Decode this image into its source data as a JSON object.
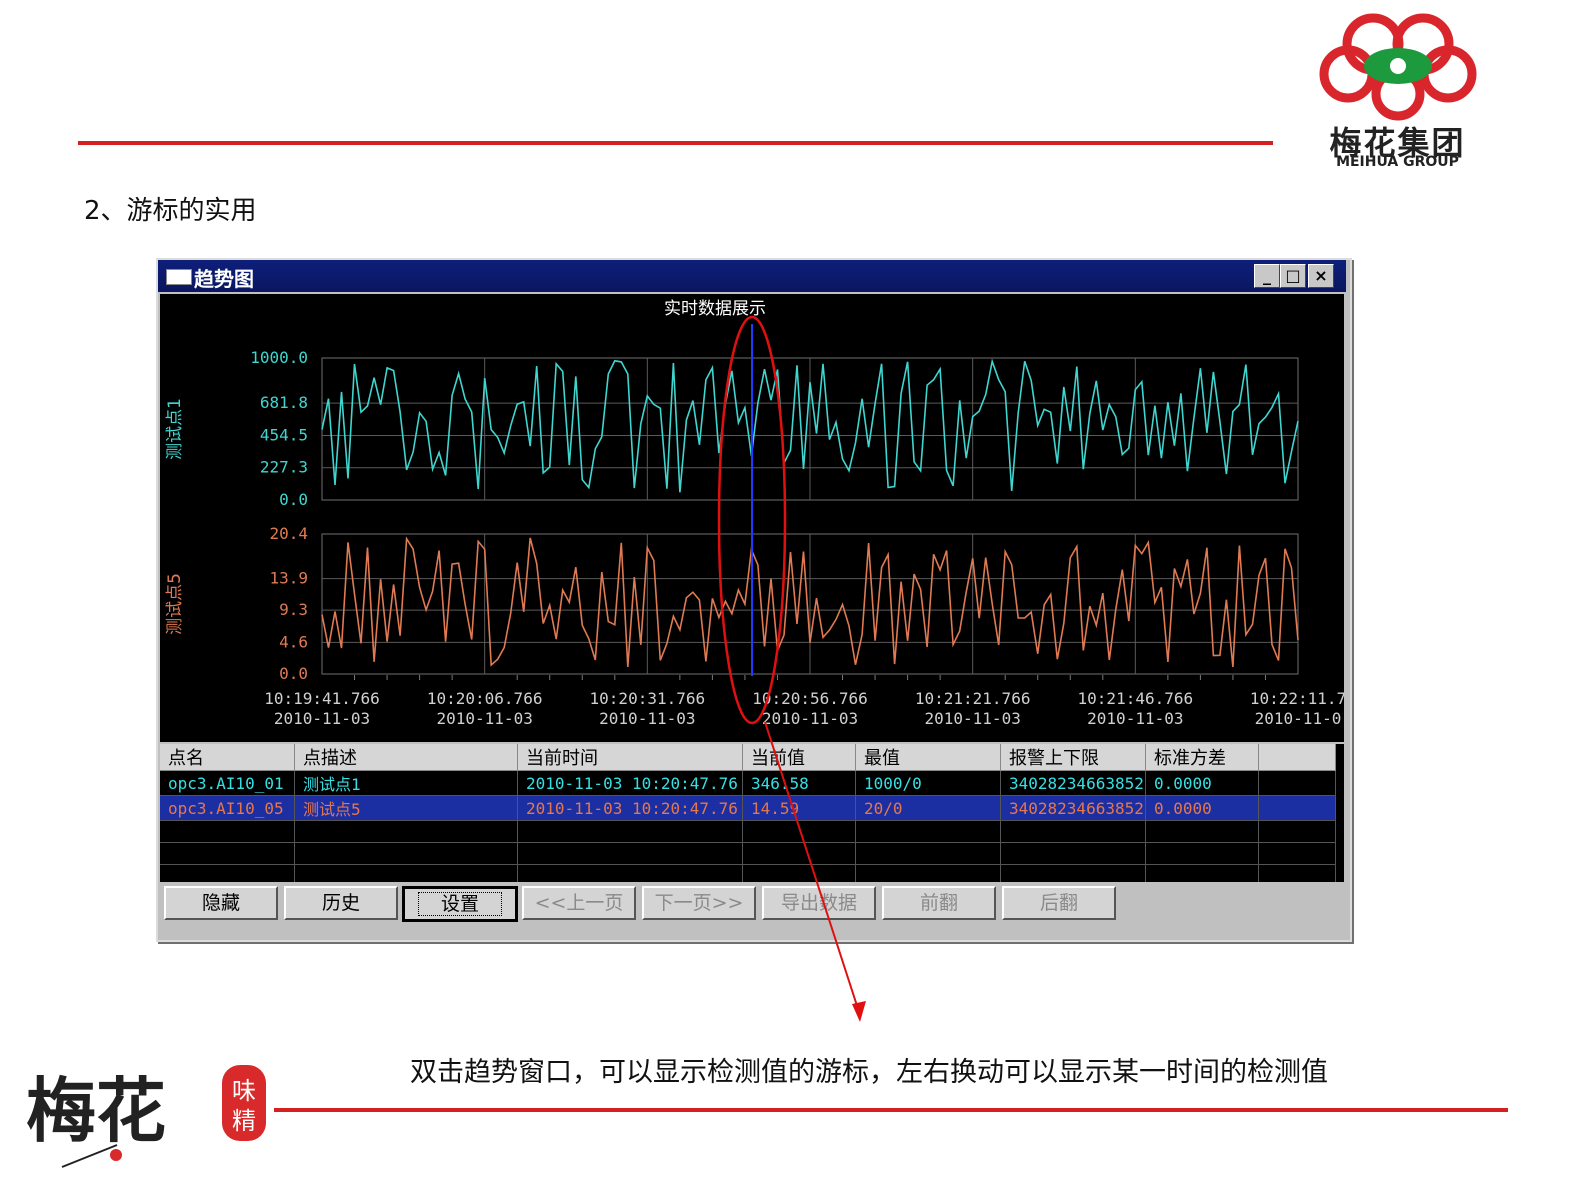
{
  "slide": {
    "heading": "2、游标的实用",
    "caption": "双击趋势窗口，可以显示检测值的游标，左右换动可以显示某一时间的检测值",
    "logo": {
      "cn": "梅花集团",
      "en": "MEIHUA GROUP"
    },
    "brand_mark": "梅花 味精",
    "colors": {
      "accent_line": "#d61f1f",
      "annotation": "#e01010"
    }
  },
  "window": {
    "title": "趋势图",
    "controls": [
      "minimize",
      "maximize",
      "close"
    ],
    "plot_title": "实时数据展示",
    "x_labels": [
      {
        "time": "10:19:41.766",
        "date": "2010-11-03"
      },
      {
        "time": "10:20:06.766",
        "date": "2010-11-03"
      },
      {
        "time": "10:20:31.766",
        "date": "2010-11-03"
      },
      {
        "time": "10:20:56.766",
        "date": "2010-11-03"
      },
      {
        "time": "10:21:21.766",
        "date": "2010-11-03"
      },
      {
        "time": "10:21:46.766",
        "date": "2010-11-03"
      },
      {
        "time": "10:22:11.7",
        "date": "2010-11-0"
      }
    ]
  },
  "chart_data": [
    {
      "type": "line",
      "series": [
        {
          "name": "测试点1",
          "color": "#3fd6d0"
        }
      ],
      "ylabel": "测试点1",
      "yticks": [
        "1000.0",
        "681.8",
        "454.5",
        "227.3",
        "0.0"
      ],
      "ylim": [
        0,
        1000
      ]
    },
    {
      "type": "line",
      "series": [
        {
          "name": "测试点5",
          "color": "#e07a52"
        }
      ],
      "ylabel": "测试点5",
      "yticks": [
        "20.4",
        "13.9",
        "9.3",
        "4.6",
        "0.0"
      ],
      "ylim": [
        0,
        20.4
      ]
    }
  ],
  "table": {
    "headers": [
      "点名",
      "点描述",
      "当前时间",
      "当前值",
      "最值",
      "报警上下限",
      "标准方差"
    ],
    "rows": [
      [
        "opc3.AI10_01",
        "测试点1",
        "2010-11-03 10:20:47.76",
        "346.58",
        "1000/0",
        "34028234663852",
        "0.0000"
      ],
      [
        "opc3.AI10_05",
        "测试点5",
        "2010-11-03 10:20:47.76",
        "14.59",
        "20/0",
        "34028234663852",
        "0.0000"
      ]
    ]
  },
  "buttons": {
    "hide": "隐藏",
    "history": "历史",
    "settings": "设置",
    "prev_page": "<<上一页",
    "next_page": "下一页>>",
    "export": "导出数据",
    "forward": "前翻",
    "backward": "后翻"
  }
}
